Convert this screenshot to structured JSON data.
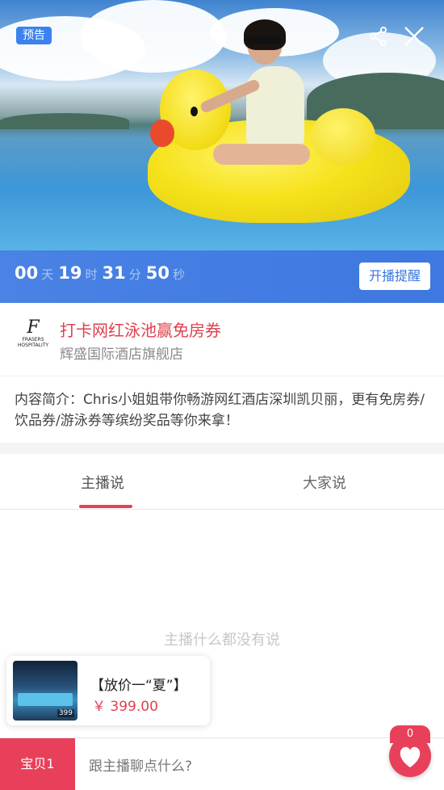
{
  "hero": {
    "badge": "预告",
    "icons": {
      "share": "share-icon",
      "close": "close-icon"
    }
  },
  "countdown": {
    "days": "00",
    "days_unit": "天",
    "hours": "19",
    "hours_unit": "时",
    "minutes": "31",
    "minutes_unit": "分",
    "seconds": "50",
    "seconds_unit": "秒",
    "remind_label": "开播提醒"
  },
  "store": {
    "logo_main": "FRASERS",
    "logo_sub": "HOSPITALITY",
    "title": "打卡网红泳池赢免房券",
    "name": "辉盛国际酒店旗舰店"
  },
  "intro": {
    "text": "内容简介：Chris小姐姐带你畅游网红酒店深圳凯贝丽，更有免房券/饮品券/游泳券等缤纷奖品等你来拿！"
  },
  "tabs": [
    {
      "label": "主播说",
      "active": true
    },
    {
      "label": "大家说",
      "active": false
    }
  ],
  "empty_hint": "主播什么都没有说",
  "product": {
    "name": "【放价一“夏”】",
    "price": "￥ 399.00",
    "thumb_price": "399"
  },
  "bottom_bar": {
    "item_button": "宝贝1",
    "chat_placeholder": "跟主播聊点什么?",
    "like_count": "0"
  },
  "colors": {
    "accent_red": "#e8405a",
    "countdown_blue": "#4a82e5",
    "badge_blue": "#3b82f0"
  }
}
